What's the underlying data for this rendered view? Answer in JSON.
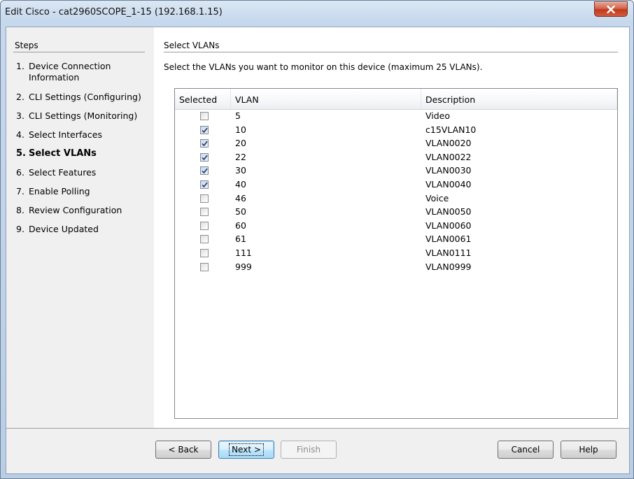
{
  "window": {
    "title": "Edit Cisco - cat2960SCOPE_1-15 (192.168.1.15)",
    "close_icon": "close-icon"
  },
  "steps": {
    "header": "Steps",
    "items": [
      {
        "num": "1.",
        "label": "Device Connection Information"
      },
      {
        "num": "2.",
        "label": "CLI Settings (Configuring)"
      },
      {
        "num": "3.",
        "label": "CLI Settings (Monitoring)"
      },
      {
        "num": "4.",
        "label": "Select Interfaces"
      },
      {
        "num": "5.",
        "label": "Select VLANs"
      },
      {
        "num": "6.",
        "label": "Select Features"
      },
      {
        "num": "7.",
        "label": "Enable Polling"
      },
      {
        "num": "8.",
        "label": "Review Configuration"
      },
      {
        "num": "9.",
        "label": "Device Updated"
      }
    ],
    "active_index": 4
  },
  "main": {
    "header": "Select VLANs",
    "instructions": "Select the VLANs you want to monitor on this device (maximum 25 VLANs).",
    "grid": {
      "columns": [
        "Selected",
        "VLAN",
        "Description"
      ],
      "rows": [
        {
          "selected": false,
          "vlan": "5",
          "description": "Video"
        },
        {
          "selected": true,
          "vlan": "10",
          "description": "c15VLAN10"
        },
        {
          "selected": true,
          "vlan": "20",
          "description": "VLAN0020"
        },
        {
          "selected": true,
          "vlan": "22",
          "description": "VLAN0022"
        },
        {
          "selected": true,
          "vlan": "30",
          "description": "VLAN0030"
        },
        {
          "selected": true,
          "vlan": "40",
          "description": "VLAN0040"
        },
        {
          "selected": false,
          "vlan": "46",
          "description": "Voice"
        },
        {
          "selected": false,
          "vlan": "50",
          "description": "VLAN0050"
        },
        {
          "selected": false,
          "vlan": "60",
          "description": "VLAN0060"
        },
        {
          "selected": false,
          "vlan": "61",
          "description": "VLAN0061"
        },
        {
          "selected": false,
          "vlan": "111",
          "description": "VLAN0111"
        },
        {
          "selected": false,
          "vlan": "999",
          "description": "VLAN0999"
        }
      ]
    }
  },
  "buttons": {
    "back": "< Back",
    "next": "Next >",
    "finish": "Finish",
    "cancel": "Cancel",
    "help": "Help"
  },
  "colors": {
    "close_button": "#c0391d",
    "default_button_border": "#3c7fb1",
    "panel_background": "#f0f0f0"
  }
}
